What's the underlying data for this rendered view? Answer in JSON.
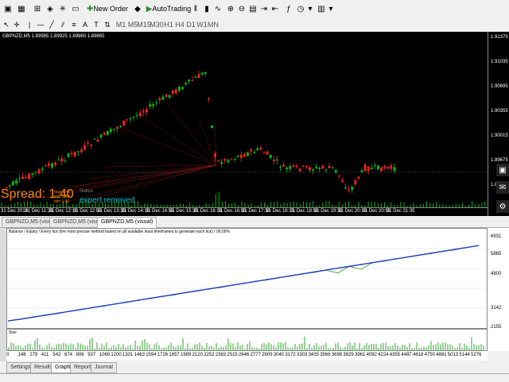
{
  "toolbar": {
    "new_order_label": "New Order",
    "autotrading_label": "AutoTrading"
  },
  "timeframes": [
    "M1",
    "M5",
    "M15",
    "M30",
    "H1",
    "H4",
    "D1",
    "W1",
    "MN"
  ],
  "chart": {
    "title": "GBPNZD,M5  1.89985 1.89925 1.89860 1.89865",
    "spread_label": "Spread: 1.40",
    "mini_labels": [
      "max",
      "avg",
      "min"
    ],
    "mini_values": [
      "1.40",
      "1.40",
      "1.40"
    ],
    "status_label": "Status",
    "status_value": "expert removed",
    "y_labels": [
      "1.91375",
      "1.91035",
      "1.90695",
      "1.90355",
      "1.90015",
      "1.89675",
      "1.89335"
    ],
    "x_labels": [
      "31 Dec 2018",
      "31 Dec 11:35",
      "31 Dec 12:15",
      "31 Dec 12:55",
      "31 Dec 13:35",
      "31 Dec 14:15",
      "31 Dec 14:55",
      "31 Dec 15:35",
      "31 Dec 16:15",
      "31 Dec 16:55",
      "31 Dec 17:35",
      "31 Dec 18:15",
      "31 Dec 18:55",
      "31 Dec 19:35",
      "31 Dec 20:15",
      "31 Dec 20:55",
      "31 Dec 21:35"
    ],
    "colors": {
      "bull": "#00c000",
      "bear": "#ff2020",
      "fan": "#b01818",
      "bg": "#000000"
    }
  },
  "chart_tabs": [
    "GBPNZD,M5 (visual)",
    "GBPNZD,M5 (visual)",
    "GBPNZD,M5 (visual)"
  ],
  "graph": {
    "legend": "Balance / Equity / Every tick (the most precise method based on all available least timeframes to generate each tick) / 90.00%",
    "y_labels": [
      "6931",
      "5865",
      "4800",
      "3142",
      "2155"
    ],
    "size_label": "Size",
    "x_labels": [
      "0",
      "148",
      "279",
      "411",
      "542",
      "674",
      "806",
      "937",
      "1069",
      "1200",
      "1331",
      "1463",
      "1594",
      "1726",
      "1857",
      "1989",
      "2120",
      "2252",
      "2383",
      "2515",
      "2646",
      "2777",
      "2909",
      "3040",
      "3172",
      "3303",
      "3435",
      "3566",
      "3698",
      "3829",
      "3961",
      "4092",
      "4224",
      "4355",
      "4487",
      "4618",
      "4750",
      "4881",
      "5013",
      "5144",
      "5276"
    ]
  },
  "chart_data": {
    "type": "line",
    "title": "",
    "x": [
      0,
      148,
      279,
      411,
      542,
      674,
      806,
      937,
      1069,
      1200,
      1331,
      1463,
      1594,
      1726,
      1857,
      1989,
      2120,
      2252,
      2383,
      2515,
      2646,
      2777,
      2909,
      3040,
      3172,
      3303,
      3435,
      3566,
      3698,
      3829,
      3961,
      4092,
      4224,
      4355,
      4487,
      4618,
      4750,
      4881,
      5013,
      5144,
      5276
    ],
    "series": [
      {
        "name": "Balance",
        "values": [
          2155,
          2255,
          2355,
          2455,
          2555,
          2655,
          2755,
          2855,
          2955,
          3055,
          3155,
          3255,
          3355,
          3455,
          3555,
          3655,
          3755,
          3855,
          3955,
          4055,
          4155,
          4255,
          4355,
          4455,
          4555,
          4655,
          4755,
          4855,
          4955,
          5055,
          5155,
          5255,
          5355,
          5455,
          5555,
          5655,
          5755,
          5855,
          5955,
          6055,
          6155
        ]
      },
      {
        "name": "Equity",
        "values": [
          2155,
          2240,
          2340,
          2455,
          2530,
          2655,
          2740,
          2850,
          2930,
          3055,
          3140,
          3255,
          3340,
          3455,
          3530,
          3655,
          3740,
          3855,
          3930,
          4055,
          4140,
          4255,
          4330,
          4455,
          4540,
          4655,
          4730,
          4855,
          4700,
          5055,
          4900,
          5255,
          5330,
          5455,
          5540,
          5655,
          5730,
          5855,
          5930,
          6055,
          6155
        ]
      }
    ],
    "ylim": [
      1900,
      6931
    ],
    "xlabel": "",
    "ylabel": ""
  },
  "bottom_tabs": [
    "Settings",
    "Results",
    "Graph",
    "Report",
    "Journal"
  ]
}
